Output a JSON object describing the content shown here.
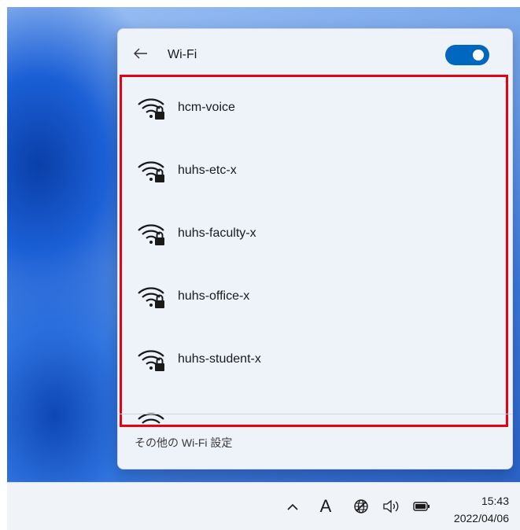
{
  "wifi_panel": {
    "title": "Wi-Fi",
    "toggle_on": true,
    "networks": [
      {
        "ssid": "hcm-voice",
        "secured": true
      },
      {
        "ssid": "huhs-etc-x",
        "secured": true
      },
      {
        "ssid": "huhs-faculty-x",
        "secured": true
      },
      {
        "ssid": "huhs-office-x",
        "secured": true
      },
      {
        "ssid": "huhs-student-x",
        "secured": true
      }
    ],
    "more_settings_label": "その他の Wi-Fi 設定",
    "highlight_color": "#e60012",
    "toggle_color": "#0067c0"
  },
  "taskbar": {
    "ime_label": "A",
    "time": "15:43",
    "date": "2022/04/06",
    "icons": [
      "chevron-up-icon",
      "network-globe-icon",
      "volume-icon",
      "battery-icon"
    ]
  }
}
